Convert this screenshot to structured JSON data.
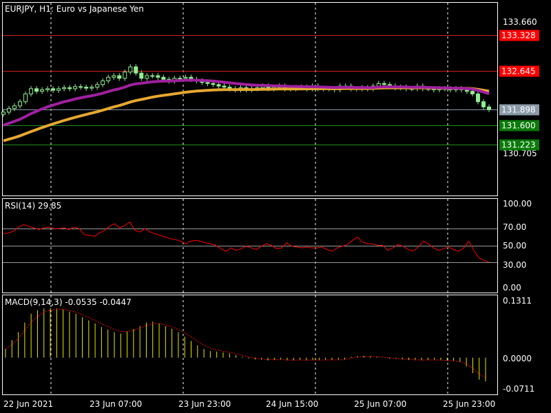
{
  "chart_header": {
    "symbol_label": "EURJPY, H1:  Euro vs Japanese Yen"
  },
  "price_panel": {
    "axis_labels": [
      "133.660",
      "130.705"
    ],
    "levels": [
      {
        "label": "133.328",
        "value": 133.328,
        "color": "#ff0000",
        "line_color": "#d02020"
      },
      {
        "label": "132.645",
        "value": 132.645,
        "color": "#ff0000",
        "line_color": "#d02020"
      },
      {
        "label": "131.898",
        "value": 131.898,
        "color": "#8a9aa8",
        "line_color": "#8a9aa8"
      },
      {
        "label": "131.600",
        "value": 131.6,
        "color": "#0a7a0a",
        "line_color": "#1f8f1f"
      },
      {
        "label": "131.223",
        "value": 131.223,
        "color": "#0a7a0a",
        "line_color": "#1f8f1f"
      }
    ],
    "ylim": [
      130.25,
      133.95
    ]
  },
  "rsi_panel": {
    "title": "RSI(14) 29.85",
    "axis_labels": [
      "100.00",
      "70.00",
      "50.00",
      "30.00",
      "0.00"
    ],
    "levels": [
      70,
      50,
      30
    ],
    "ylim": [
      0,
      100
    ],
    "line_color": "#ff0000"
  },
  "macd_panel": {
    "title": "MACD(9,14,3) -0.0535 -0.0447",
    "axis_labels": [
      "0.1311",
      "0.0000",
      "-0.0711"
    ],
    "ylim": [
      -0.0711,
      0.1311
    ],
    "histogram_color": "#e8e800",
    "signal_color": "#ff0000"
  },
  "time_axis": {
    "labels": [
      "22 Jun 2021",
      "23 Jun 07:00",
      "23 Jun 23:00",
      "24 Jun 15:00",
      "25 Jun 07:00",
      "25 Jun 23:00"
    ]
  },
  "colors": {
    "bull_candle": "#90ee90",
    "ma_fast": "#a020a0",
    "ma_slow": "#e6a830",
    "grid": "#ffffff"
  },
  "chart_data": {
    "type": "line",
    "x_labels": [
      "22 Jun 2021",
      "23 Jun 07:00",
      "23 Jun 23:00",
      "24 Jun 15:00",
      "25 Jun 07:00",
      "25 Jun 23:00"
    ],
    "price_close": [
      131.85,
      131.92,
      131.97,
      132.05,
      132.2,
      132.3,
      132.25,
      132.28,
      132.3,
      132.27,
      132.3,
      132.32,
      132.3,
      132.34,
      132.33,
      132.31,
      132.33,
      132.38,
      132.45,
      132.52,
      132.55,
      132.5,
      132.62,
      132.72,
      132.6,
      132.5,
      132.55,
      132.55,
      132.52,
      132.48,
      132.45,
      132.5,
      132.5,
      132.52,
      132.48,
      132.45,
      132.42,
      132.4,
      132.38,
      132.35,
      132.33,
      132.3,
      132.28,
      132.32,
      132.28,
      132.3,
      132.32,
      132.35,
      132.3,
      132.33,
      132.35,
      132.3,
      132.3,
      132.32,
      132.33,
      132.3,
      132.35,
      132.3,
      132.3,
      132.3,
      132.28,
      132.35,
      132.35,
      132.3,
      132.3,
      132.32,
      132.3,
      132.35,
      132.4,
      132.38,
      132.35,
      132.32,
      132.33,
      132.3,
      132.3,
      132.35,
      132.3,
      132.3,
      132.28,
      132.3,
      132.3,
      132.28,
      132.3,
      132.28,
      132.25,
      132.2,
      132.05,
      131.95,
      131.9
    ],
    "series": [
      {
        "name": "RSI(14)",
        "values": [
          64,
          65,
          67,
          72,
          75,
          73,
          71,
          69,
          71,
          72,
          70,
          70,
          71,
          69,
          72,
          70,
          63,
          62,
          61,
          65,
          68,
          73,
          76,
          71,
          74,
          78,
          68,
          66,
          70,
          66,
          64,
          62,
          60,
          58,
          57,
          55,
          52,
          55,
          56,
          55,
          53,
          52,
          50,
          46,
          43,
          47,
          44,
          46,
          49,
          47,
          45,
          49,
          52,
          50,
          46,
          47,
          53,
          49,
          48,
          47,
          48,
          47,
          47,
          48,
          45,
          43,
          47,
          49,
          51,
          56,
          60,
          54,
          52,
          52,
          50,
          50,
          44,
          47,
          51,
          49,
          45,
          43,
          48,
          55,
          52,
          47,
          44,
          46,
          48,
          45,
          43,
          47,
          55,
          44,
          35,
          32,
          30
        ]
      },
      {
        "name": "MACD(9,14,3)",
        "values": [
          0.02,
          0.04,
          0.058,
          0.08,
          0.1,
          0.108,
          0.112,
          0.113,
          0.112,
          0.11,
          0.105,
          0.1,
          0.092,
          0.085,
          0.078,
          0.07,
          0.064,
          0.058,
          0.055,
          0.06,
          0.065,
          0.072,
          0.08,
          0.082,
          0.078,
          0.072,
          0.066,
          0.058,
          0.048,
          0.038,
          0.028,
          0.02,
          0.015,
          0.014,
          0.012,
          0.01,
          0.006,
          0.002,
          -0.002,
          -0.004,
          -0.005,
          -0.006,
          -0.005,
          -0.004,
          -0.006,
          -0.006,
          -0.005,
          -0.006,
          -0.005,
          -0.006,
          -0.005,
          -0.005,
          -0.005,
          -0.004,
          0.002,
          0.004,
          0.004,
          0.003,
          0.002,
          0.0,
          -0.002,
          -0.003,
          -0.004,
          -0.005,
          -0.006,
          -0.006,
          -0.005,
          -0.005,
          -0.006,
          -0.007,
          -0.008,
          -0.01,
          -0.02,
          -0.035,
          -0.05,
          -0.054
        ]
      }
    ],
    "rsi_ylim": [
      0,
      100
    ],
    "macd_ylim": [
      -0.0711,
      0.1311
    ],
    "price_ylim": [
      130.25,
      133.95
    ]
  }
}
